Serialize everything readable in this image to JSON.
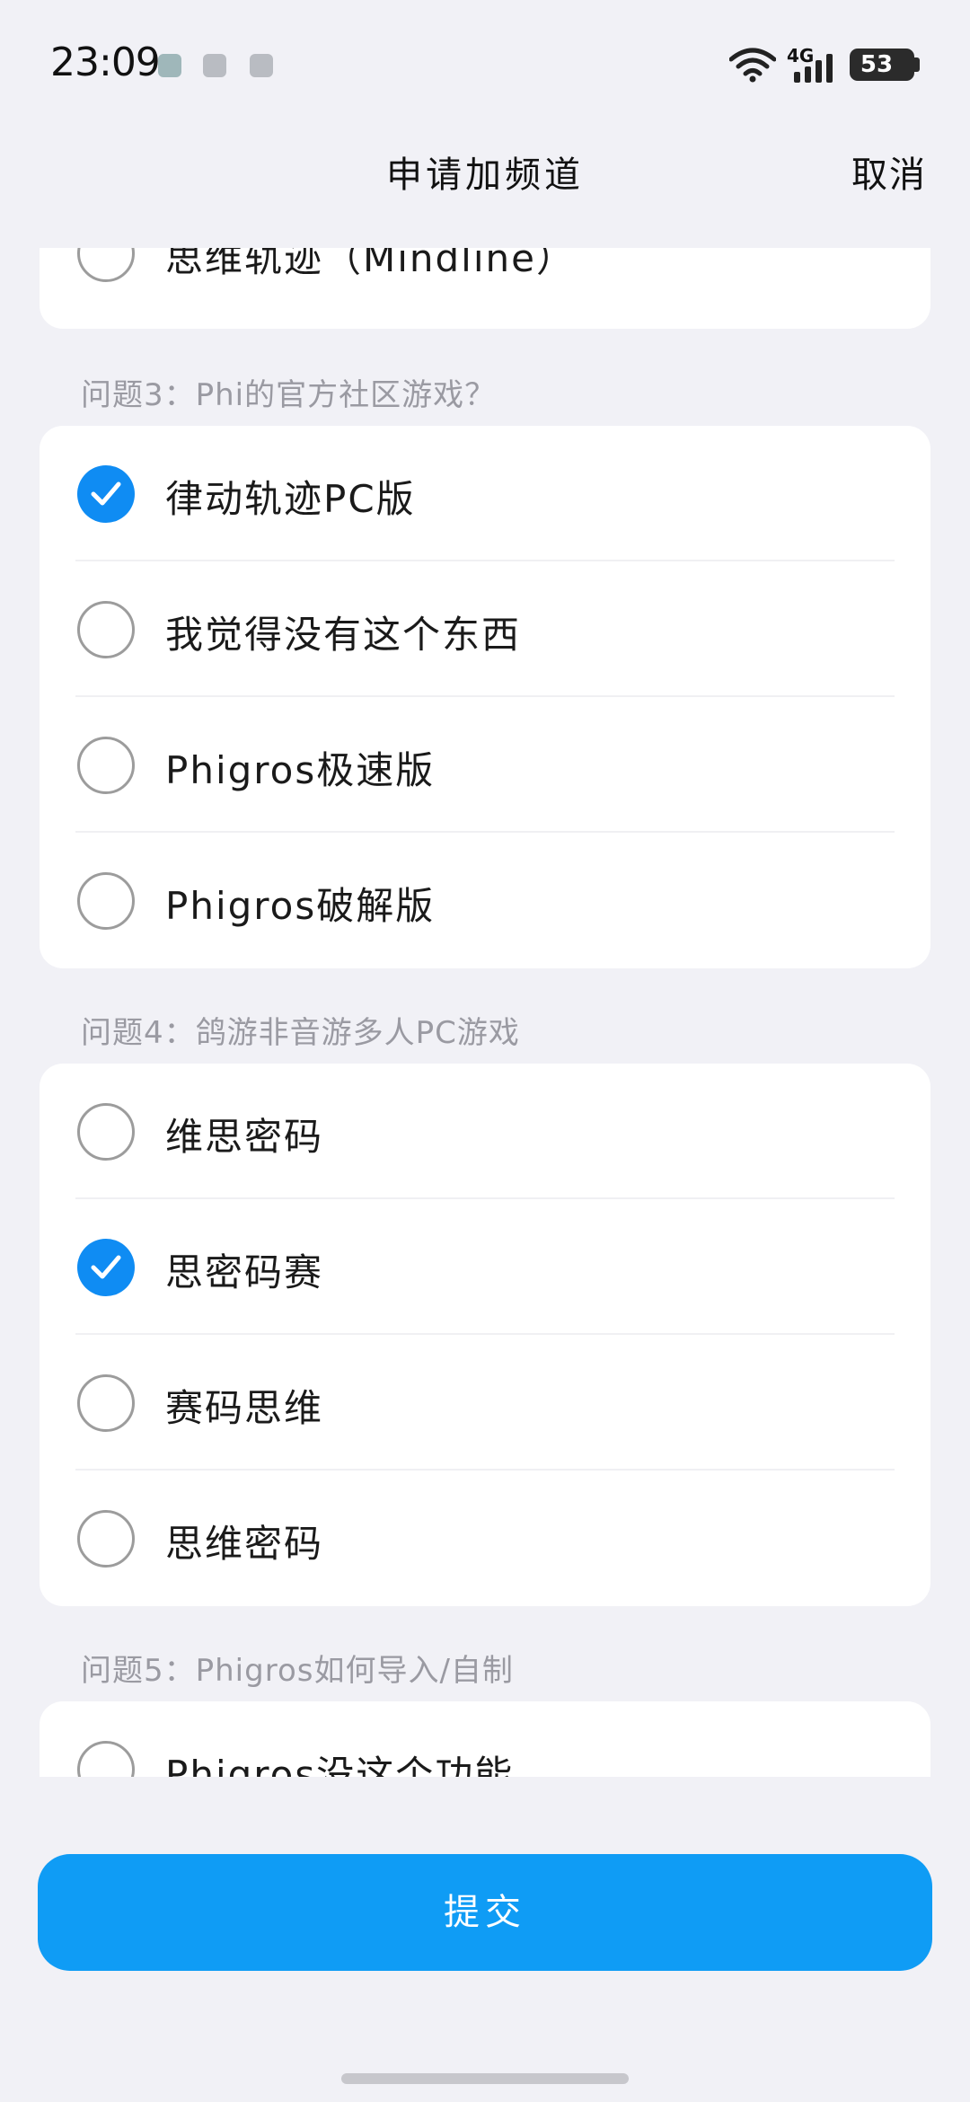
{
  "status_bar": {
    "time": "23:09",
    "network": "4G",
    "battery": "53"
  },
  "header": {
    "title": "申请加频道",
    "cancel_label": "取消"
  },
  "question2": {
    "options": [
      {
        "label": "思维轨迹（Mindline）",
        "checked": false
      }
    ]
  },
  "question3": {
    "label": "问题3：Phi的官方社区游戏？",
    "options": [
      {
        "label": "律动轨迹PC版",
        "checked": true
      },
      {
        "label": "我觉得没有这个东西",
        "checked": false
      },
      {
        "label": "Phigros极速版",
        "checked": false
      },
      {
        "label": "Phigros破解版",
        "checked": false
      }
    ]
  },
  "question4": {
    "label": "问题4：鸽游非音游多人PC游戏",
    "options": [
      {
        "label": "维思密码",
        "checked": false
      },
      {
        "label": "思密码赛",
        "checked": true
      },
      {
        "label": "赛码思维",
        "checked": false
      },
      {
        "label": "思维密码",
        "checked": false
      }
    ]
  },
  "question5": {
    "label": "问题5：Phigros如何导入/自制",
    "options": [
      {
        "label": "Phigros没这个功能",
        "checked": false
      }
    ]
  },
  "submit_label": "提交",
  "colors": {
    "accent": "#0f9cf5",
    "background": "#f1f1f6",
    "label_gray": "#9a9aa2"
  }
}
